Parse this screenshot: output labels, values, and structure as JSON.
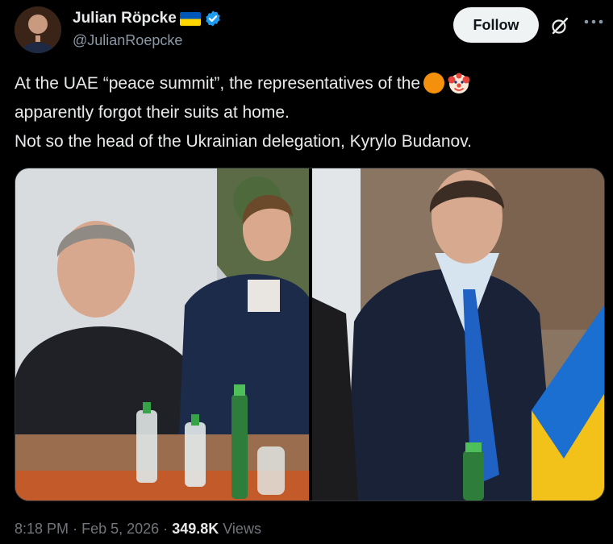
{
  "author": {
    "display_name": "Julian Röpcke",
    "handle": "@JulianRoepcke",
    "badge_icon": "ukraine-flag-icon",
    "verified_icon": "verified-badge-icon",
    "verified_color": "#1d9bf0"
  },
  "header": {
    "follow_label": "Follow",
    "grok_icon": "grok-icon",
    "more_icon": "more-options-icon"
  },
  "tweet": {
    "line1": "At the UAE “peace summit”, the representatives of the",
    "line2": "apparently forgot their suits at home.",
    "line3": "Not so the head of the Ukrainian delegation, Kyrylo Budanov.",
    "emojis": [
      "orange-circle-emoji",
      "clown-face-emoji"
    ]
  },
  "media": {
    "type": "photo",
    "panels": 2
  },
  "footer": {
    "time": "8:18 PM",
    "separator": "·",
    "date": "Feb 5, 2026",
    "views_count": "349.8K",
    "views_label": "Views"
  },
  "colors": {
    "background": "#000000",
    "text": "#e7e9ea",
    "muted": "#71767b",
    "follow_bg": "#eff3f4",
    "ukraine_blue": "#0057b7",
    "ukraine_yellow": "#ffd700"
  }
}
